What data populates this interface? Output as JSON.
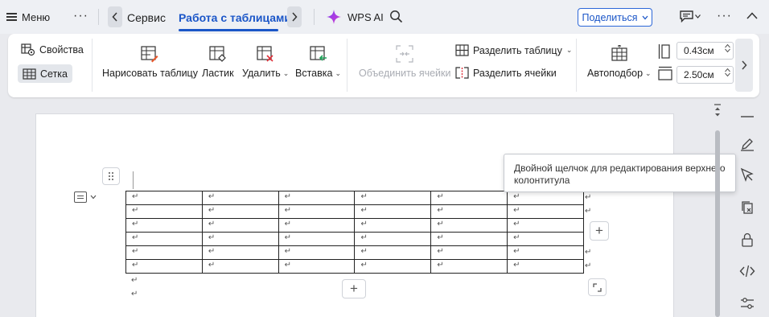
{
  "topbar": {
    "menu_label": "Меню",
    "more": "···",
    "tab_service": "Сервис",
    "tab_tables": "Работа с таблицами",
    "wps_ai": "WPS AI",
    "share_label": "Поделиться",
    "accent": "#1b56c8"
  },
  "ribbon": {
    "properties": "Свойства",
    "grid": "Сетка",
    "draw_table": "Нарисовать таблицу",
    "eraser": "Ластик",
    "delete": "Удалить",
    "insert": "Вставка",
    "merge_cells": "Объединить ячейки",
    "split_table": "Разделить таблицу",
    "split_cells": "Разделить ячейки",
    "autofit": "Автоподбор",
    "width_value": "0.43см",
    "height_value": "2.50см",
    "caret": "⌄",
    "next": "›"
  },
  "document": {
    "para_mark": "↵",
    "rows": [
      [
        "↵",
        "↵",
        "↵",
        "↵",
        "↵",
        "↵"
      ],
      [
        "↵",
        "↵",
        "↵",
        "↵",
        "↵",
        "↵"
      ],
      [
        "↵",
        "↵",
        "↵",
        "↵",
        "↵",
        "↵"
      ],
      [
        "↵",
        "↵",
        "↵",
        "↵",
        "↵",
        "↵"
      ],
      [
        "↵",
        "↵",
        "↵",
        "↵",
        "↵",
        "↵"
      ],
      [
        "↵",
        "↵",
        "↵",
        "↵",
        "↵",
        "↵"
      ]
    ],
    "add": "+"
  },
  "tooltip": {
    "text": "Двойной щелчок для редактирования верхнего колонтитула"
  },
  "sidebar": {
    "icons": [
      "minus-icon",
      "pen-icon",
      "pointer-icon",
      "document-compare-icon",
      "lock-icon",
      "code-icon",
      "sliders-icon"
    ]
  }
}
